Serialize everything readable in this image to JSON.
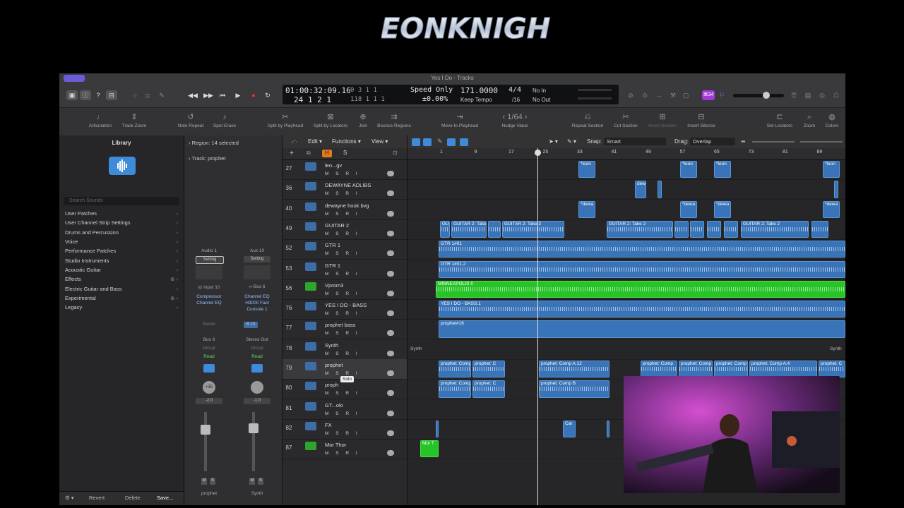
{
  "logo": {
    "text": "LEONKNIGHT"
  },
  "window": {
    "title": "Yes I Do - Tracks"
  },
  "lcd": {
    "time": "01:00:32:09.16",
    "bars_a": "0  3  1  1",
    "beats": "24  1  2  1",
    "bars_b": "118  1  1  1",
    "mode": "Speed Only",
    "percent": "±0.00%",
    "tempo": "171.0000",
    "tempo_label": "Keep Tempo",
    "signature": "4/4",
    "division": "/16",
    "in_label": "No In",
    "out_label": "No Out",
    "badge": "⌘34"
  },
  "toolbar": [
    "Articulation",
    "Track Zoom",
    "Note Repeat",
    "Spot Erase",
    "Split by Playhead",
    "Split by Locators",
    "Join",
    "Bounce Regions",
    "Move to Playhead",
    "Nudge Value",
    "Repeat Section",
    "Cut Section",
    "Insert Section",
    "Insert Silence",
    "Set Locators",
    "Zoom",
    "Colors"
  ],
  "nudge_value": "1/64",
  "library": {
    "title": "Library",
    "search_placeholder": "Search Sounds",
    "items": [
      "User Patches",
      "User Channel Strip Settings",
      "Drums and Percussion",
      "Voice",
      "Performance Patches",
      "Studio Instruments",
      "Acoustic Guitar",
      "Effects",
      "Electric Guitar and Bass",
      "Experimental",
      "Legacy"
    ],
    "footer": {
      "revert": "Revert",
      "delete": "Delete",
      "save": "Save..."
    }
  },
  "inspector": {
    "region": "Region: 14 selected",
    "track": "Track: prophet",
    "strip1": {
      "name": "Audio 1",
      "setting": "Setting",
      "input": "Input 10",
      "plugin1": "Compressor",
      "plugin2": "Channel EQ",
      "sends": "Sends",
      "bus": "Bus 6",
      "group": "Group",
      "read": "Read",
      "pan": "+35",
      "vol": "-2.0",
      "m": "M",
      "s": "S",
      "label": "prophet"
    },
    "strip2": {
      "name": "Aux 10",
      "setting": "Setting",
      "input": "Bus 6",
      "plugin1": "Channel EQ",
      "plugin2": "H3000 Fact",
      "plugin3": "Console 1",
      "bus": "B 10",
      "out": "Stereo Out",
      "group": "Group",
      "read": "Read",
      "vol": "-1.0",
      "m": "M",
      "s": "S",
      "label": "Synth"
    }
  },
  "menus": {
    "edit": "Edit",
    "functions": "Functions",
    "view": "View",
    "snap_label": "Snap:",
    "snap": "Smart",
    "drag_label": "Drag:",
    "drag": "Overlap"
  },
  "header_buttons": {
    "h": "H",
    "s": "S"
  },
  "ruler": [
    "1",
    "9",
    "17",
    "25",
    "33",
    "41",
    "49",
    "57",
    "65",
    "73",
    "81",
    "89"
  ],
  "tracks": [
    {
      "num": "27",
      "name": "leo...gv",
      "color": "#3d6ea8"
    },
    {
      "num": "36",
      "name": "DEWAYNE ADLIBS",
      "color": "#3d6ea8"
    },
    {
      "num": "40",
      "name": "dewayne hook bvg",
      "color": "#3d6ea8"
    },
    {
      "num": "49",
      "name": "GUITAR 2",
      "color": "#3d6ea8"
    },
    {
      "num": "52",
      "name": "GTR 1",
      "color": "#3d6ea8"
    },
    {
      "num": "53",
      "name": "GTR 1",
      "color": "#3d6ea8"
    },
    {
      "num": "56",
      "name": "Vprom3",
      "color": "#2ea62e"
    },
    {
      "num": "76",
      "name": "YES I DO - BASS",
      "color": "#3d6ea8"
    },
    {
      "num": "77",
      "name": "prophet bass",
      "color": "#3d6ea8"
    },
    {
      "num": "78",
      "name": "Synth",
      "color": "#3d6ea8"
    },
    {
      "num": "79",
      "name": "prophet",
      "color": "#3d6ea8"
    },
    {
      "num": "80",
      "name": "proph",
      "color": "#3d6ea8"
    },
    {
      "num": "81",
      "name": "GT...olo",
      "color": "#3d6ea8"
    },
    {
      "num": "82",
      "name": "FX",
      "color": "#3d6ea8"
    },
    {
      "num": "87",
      "name": "Mor Thor",
      "color": "#2ea62e"
    }
  ],
  "track_controls": "M S R I",
  "tooltip": "Solo",
  "regions": {
    "leon": "*leon",
    "dew": "dew",
    "dewa": "*dewa",
    "guitar2": "GUITAR 2: Take 2",
    "gui": "GUI",
    "gtr1": "GTR 1#01",
    "gtr12": "GTR 1#01.2",
    "minneapolis": "MINNEAPOLIS II",
    "bass": "YES I DO - BASS.1",
    "prophet16": "prophet#16",
    "synth": "Synth",
    "prophet_comp": "prophet: Comp",
    "prophet_comp_a12": "prophet: Comp A.12",
    "prophet_comp_a4": "prophet: Comp A.4",
    "prophet_comp_b": "prophet: Comp B",
    "prophet_c": "prophet: C",
    "car": "Car",
    "mor": "Mor T"
  }
}
